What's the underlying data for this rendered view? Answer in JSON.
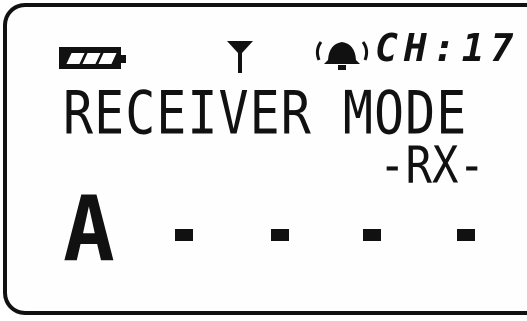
{
  "status": {
    "battery_level": 1.0,
    "antenna_icon": "antenna-icon",
    "alarm_icon": "bell-icon",
    "channel_label": "CH:17"
  },
  "screen": {
    "title": "RECEIVER MODE",
    "subtitle": "-RX-",
    "slot_letter": "A",
    "dashes": [
      "-",
      "-",
      "-",
      "-"
    ]
  },
  "colors": {
    "lcd_background": "#fefefe",
    "segment": "#111111"
  }
}
